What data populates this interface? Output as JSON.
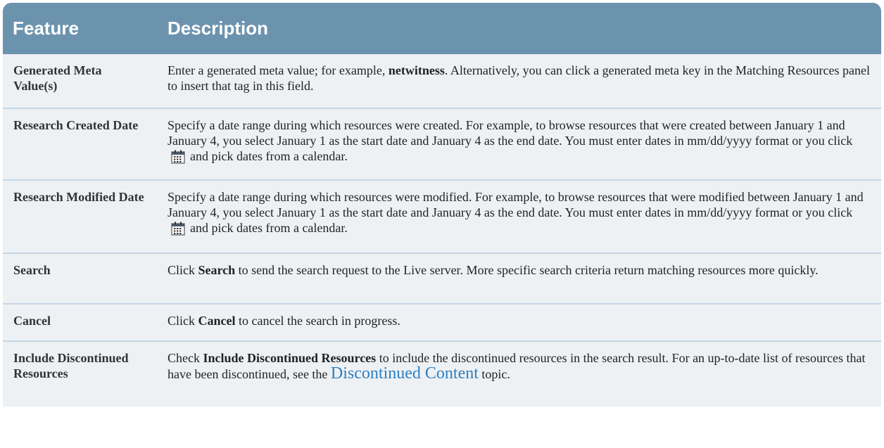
{
  "header": {
    "feature": "Feature",
    "description": "Description"
  },
  "rows": [
    {
      "feature": "Generated Meta Value(s)",
      "d1": "Enter a generated meta value; for example, ",
      "d1b": "netwitness",
      "d2": ". Alternatively, you can click a generated meta key in the Matching Resources panel to insert that tag in this field."
    },
    {
      "feature": "Research Created Date",
      "d1": "Specify a date range during which resources were created. For example, to browse resources that were created between January 1 and January 4, you select January 1 as the start date and January 4 as the end date. You must enter dates in mm/dd/yyyy format or you click",
      "d2": "and pick dates from a calendar."
    },
    {
      "feature": "Research Modified Date",
      "d1": "Specify a date range during which resources were modified. For example, to browse resources that were modified between January 1 and January 4, you select January 1 as the start date and January 4 as the end date. You must enter dates in mm/dd/yyyy format or you click",
      "d2": "and pick dates from a calendar."
    },
    {
      "feature": "Search",
      "d1": "Click ",
      "d1b": "Search",
      "d2": " to send the search request to the Live server. More specific search criteria return matching resources more quickly."
    },
    {
      "feature": "Cancel",
      "d1": "Click ",
      "d1b": "Cancel",
      "d2": " to cancel the search in progress."
    },
    {
      "feature": "Include Discontinued Resources",
      "d1": "Check ",
      "d1b": "Include Discontinued Resources",
      "d2": " to include the discontinued resources in the search result. For an up-to-date list of resources that have been discontinued, see the ",
      "link": "Discontinued Content",
      "d3": " topic."
    }
  ],
  "icons": {
    "calendar": "calendar-icon"
  },
  "colors": {
    "header_bg": "#6c93ae",
    "row_bg": "#eef1f4",
    "link": "#2f7fc1"
  }
}
